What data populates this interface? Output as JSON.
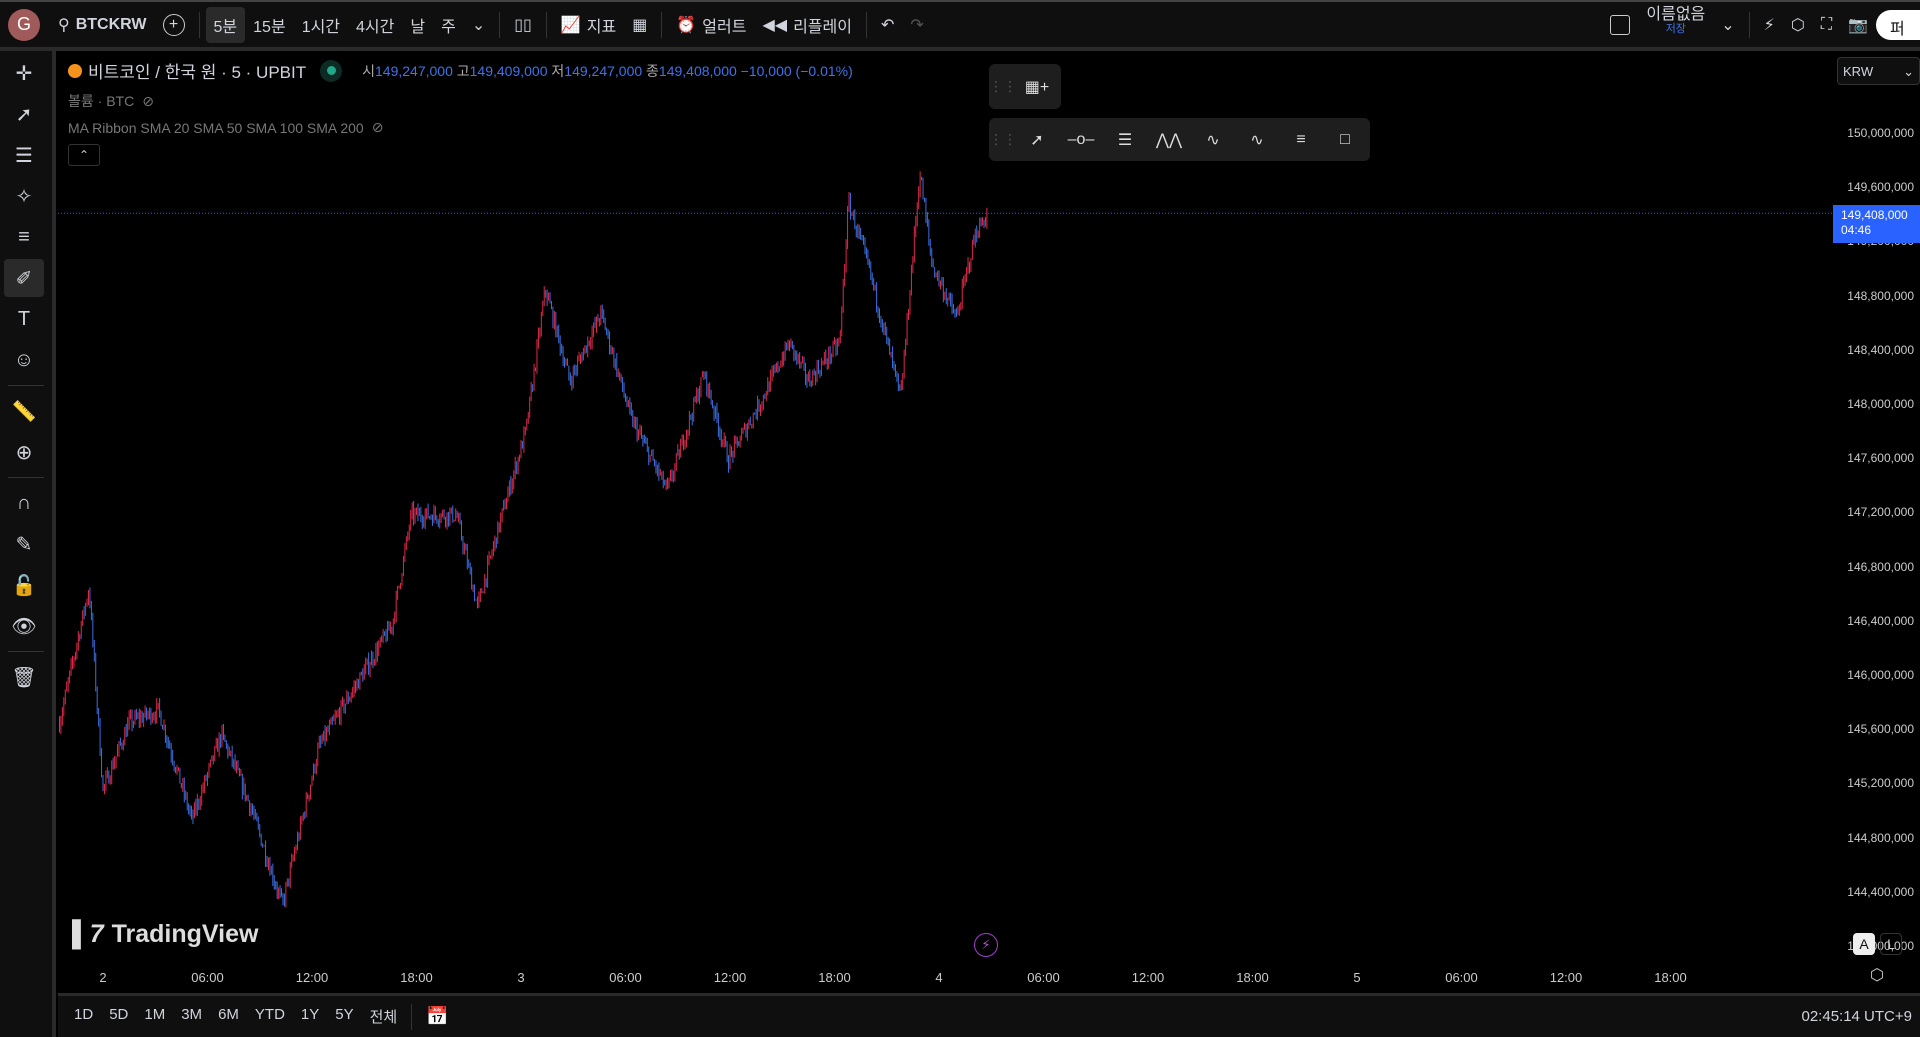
{
  "topbar": {
    "avatar": "G",
    "symbol": "BTCKRW",
    "intervals": [
      "5분",
      "15분",
      "1시간",
      "4시간",
      "날",
      "주"
    ],
    "active_interval": "5분",
    "indicators": "지표",
    "alert": "얼러트",
    "replay": "리플레이",
    "layout_name": "이름없음",
    "save": "저장",
    "publish": "퍼블"
  },
  "legend": {
    "title": "비트코인 / 한국 원 · 5 · UPBIT",
    "o_label": "시",
    "o": "149,247,000",
    "h_label": "고",
    "h": "149,409,000",
    "l_label": "저",
    "l": "149,247,000",
    "c_label": "종",
    "c": "149,408,000",
    "change": "−10,000 (−0.01%)",
    "volume": "볼륨 · BTC",
    "ma": "MA Ribbon SMA 20 SMA 50 SMA 100 SMA 200"
  },
  "left_tools": [
    "crosshair-icon",
    "trendline-icon",
    "fib-icon",
    "pattern-icon",
    "forecast-icon",
    "brush-icon",
    "text-icon",
    "emoji-icon",
    "ruler-icon",
    "zoom-in-icon",
    "magnet-icon",
    "lock-draw-icon",
    "lock-icon",
    "eye-icon",
    "trash-icon"
  ],
  "price_axis": {
    "currency": "KRW",
    "labels": [
      "150,000,000",
      "149,600,000",
      "149,200,000",
      "148,800,000",
      "148,400,000",
      "148,000,000",
      "147,600,000",
      "147,200,000",
      "146,800,000",
      "146,400,000",
      "146,000,000",
      "145,600,000",
      "145,200,000",
      "144,800,000",
      "144,400,000",
      "144,000,000"
    ],
    "current_price": "149,408,000",
    "countdown": "04:46"
  },
  "time_axis": [
    "2",
    "06:00",
    "12:00",
    "18:00",
    "3",
    "06:00",
    "12:00",
    "18:00",
    "4",
    "06:00",
    "12:00",
    "18:00",
    "5",
    "06:00",
    "12:00",
    "18:00"
  ],
  "bottombar": {
    "ranges": [
      "1D",
      "5D",
      "1M",
      "3M",
      "6M",
      "YTD",
      "1Y",
      "5Y",
      "전체"
    ],
    "clock": "02:45:14 UTC+9"
  },
  "branding": "TradingView",
  "scale_buttons": {
    "auto": "A",
    "log": "L"
  },
  "colors": {
    "up": "#e0294a",
    "down": "#3b6fe0",
    "accent": "#2962ff"
  },
  "chart_data": {
    "type": "candlestick",
    "interval_minutes": 5,
    "x_unit": "hours since day 2 00:00",
    "current": 149408000,
    "path": [
      [
        -2.5,
        145650000
      ],
      [
        -0.8,
        146640000
      ],
      [
        0,
        145150000
      ],
      [
        1.5,
        145650000
      ],
      [
        3.2,
        145740000
      ],
      [
        5.1,
        144930000
      ],
      [
        6.8,
        145560000
      ],
      [
        8.5,
        145020000
      ],
      [
        10.3,
        144300000
      ],
      [
        12.4,
        145470000
      ],
      [
        14.5,
        145920000
      ],
      [
        16.6,
        146370000
      ],
      [
        17.7,
        147180000
      ],
      [
        20.3,
        147180000
      ],
      [
        21.5,
        146500000
      ],
      [
        22.9,
        147180000
      ],
      [
        24.3,
        147810000
      ],
      [
        25.4,
        148850000
      ],
      [
        26.8,
        148170000
      ],
      [
        28.6,
        148670000
      ],
      [
        30.3,
        147900000
      ],
      [
        32.4,
        147360000
      ],
      [
        34.5,
        148220000
      ],
      [
        35.9,
        147590000
      ],
      [
        37.7,
        148000000
      ],
      [
        39.4,
        148450000
      ],
      [
        40.5,
        148170000
      ],
      [
        42.3,
        148450000
      ],
      [
        42.8,
        149490000
      ],
      [
        44.0,
        148990000
      ],
      [
        45.8,
        148040000
      ],
      [
        46.9,
        149710000
      ],
      [
        47.6,
        149030000
      ],
      [
        49.0,
        148630000
      ],
      [
        50.1,
        149260000
      ],
      [
        50.8,
        149408000
      ]
    ],
    "ylim": [
      144000000,
      150000000
    ]
  }
}
